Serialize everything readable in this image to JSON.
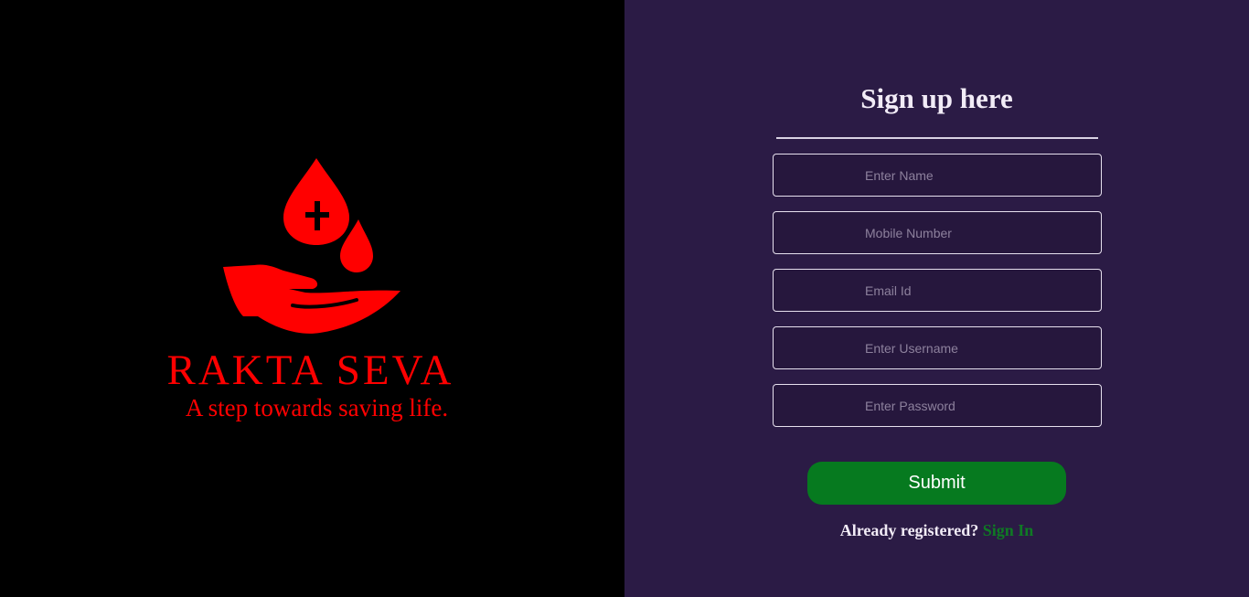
{
  "brand": {
    "name": "RAKTA SEVA",
    "tagline": "A step towards saving life.",
    "logo_icon": "blood-drop-hand-icon",
    "color": "#ff0000"
  },
  "form": {
    "title": "Sign up here",
    "fields": {
      "name_placeholder": "Enter Name",
      "mobile_placeholder": "Mobile Number",
      "email_placeholder": "Email Id",
      "username_placeholder": "Enter Username",
      "password_placeholder": "Enter Password"
    },
    "submit_label": "Submit",
    "signin_prompt": "Already registered?",
    "signin_link": "Sign In"
  },
  "colors": {
    "left_background": "#000000",
    "right_background": "#2b1b45",
    "submit_button": "#067a1f",
    "signin_link": "#0f7a24"
  }
}
